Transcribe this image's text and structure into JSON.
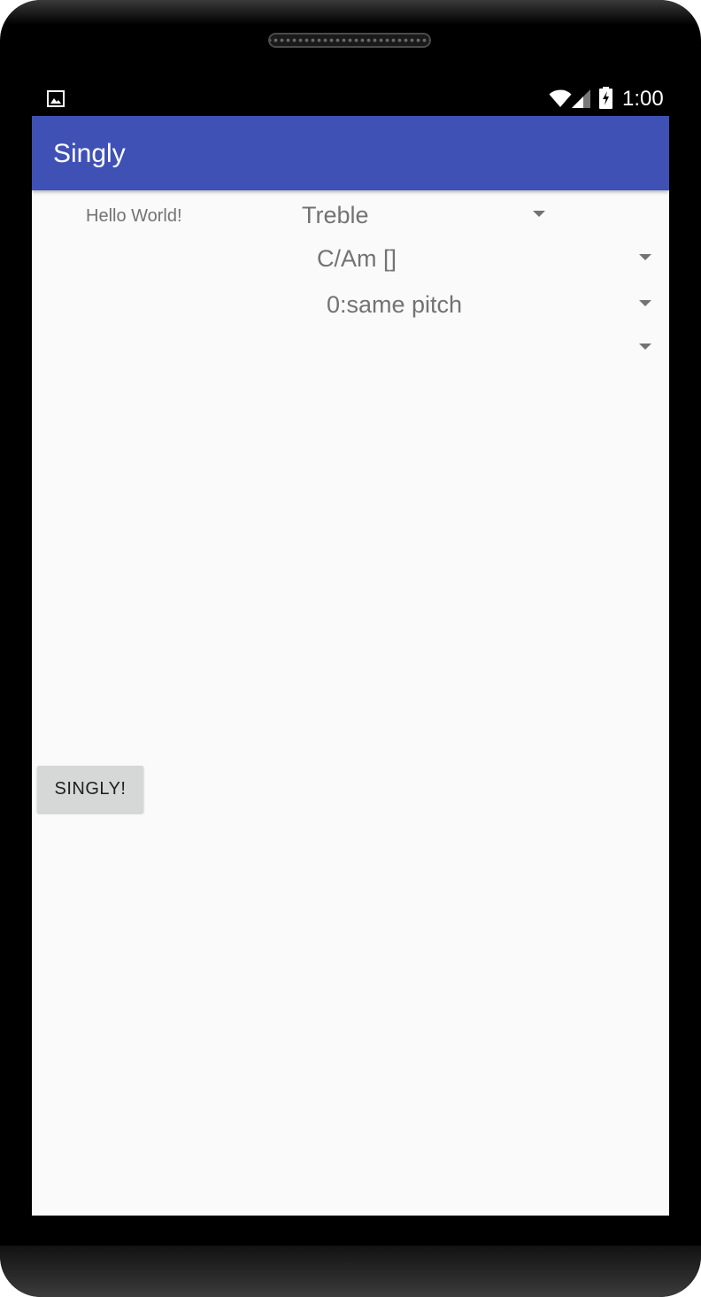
{
  "status_bar": {
    "time": "1:00",
    "icons": [
      "gallery-icon",
      "wifi-icon",
      "signal-icon",
      "battery-charging-icon"
    ]
  },
  "app_bar": {
    "title": "Singly",
    "color": "#3f51b5"
  },
  "main": {
    "hello_text": "Hello World!",
    "spinners": [
      {
        "value": "Treble"
      },
      {
        "value": "C/Am []"
      },
      {
        "value": "0:same pitch"
      },
      {
        "value": ""
      }
    ],
    "button_label": "SINGLY!"
  },
  "colors": {
    "screen_background": "#fafafa",
    "secondary_text": "#737373",
    "button_background": "#d6d7d7"
  }
}
